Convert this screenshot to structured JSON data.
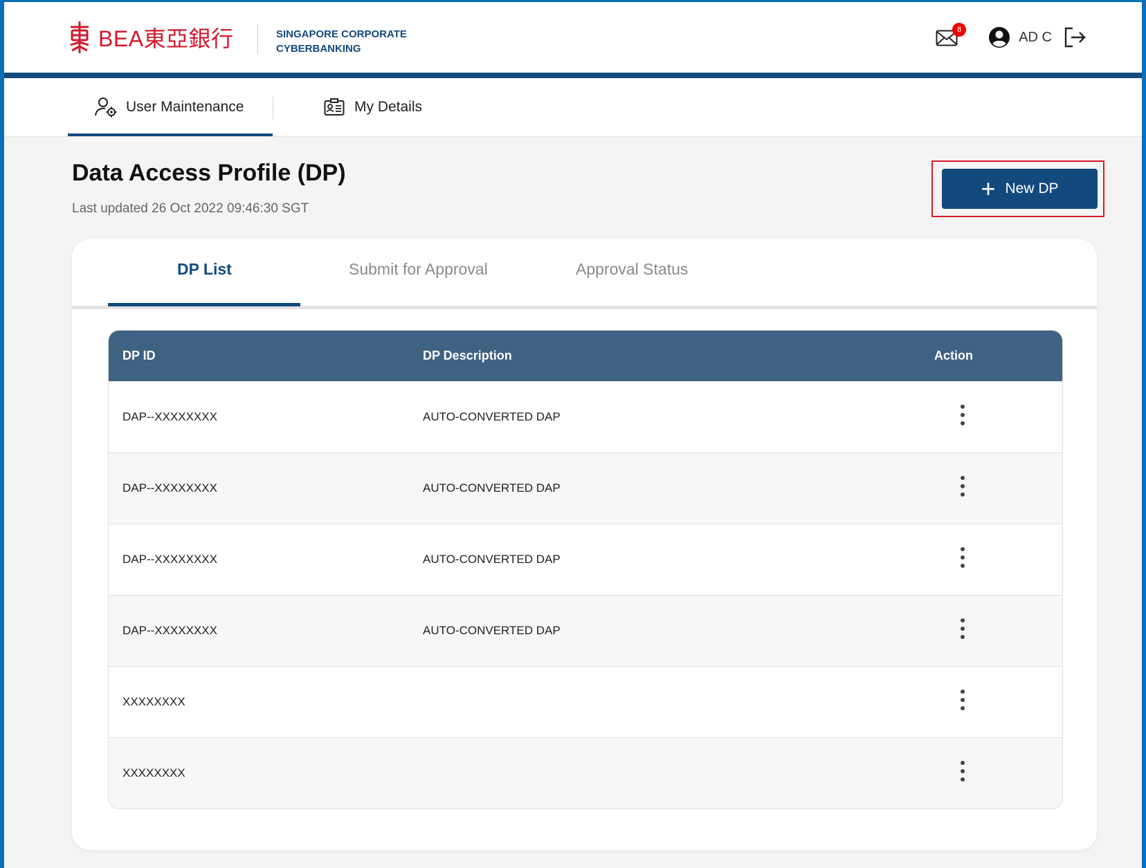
{
  "header": {
    "logo_text": "BEA東亞銀行",
    "subtitle_line1": "SINGAPORE CORPORATE",
    "subtitle_line2": "CYBERBANKING",
    "mail_badge_count": "8",
    "user_name": "AD C"
  },
  "topnav": {
    "tabs": [
      {
        "label": "User Maintenance",
        "active": true
      },
      {
        "label": "My Details",
        "active": false
      }
    ]
  },
  "page": {
    "title": "Data Access Profile (DP)",
    "last_updated": "Last updated 26 Oct 2022 09:46:30 SGT",
    "new_button_label": "New DP"
  },
  "card_tabs": [
    {
      "label": "DP List",
      "active": true
    },
    {
      "label": "Submit for Approval",
      "active": false
    },
    {
      "label": "Approval Status",
      "active": false
    }
  ],
  "table": {
    "columns": [
      "DP ID",
      "DP Description",
      "Action"
    ],
    "rows": [
      {
        "dp_id": "DAP--XXXXXXXX",
        "description": "AUTO-CONVERTED DAP"
      },
      {
        "dp_id": "DAP--XXXXXXXX",
        "description": "AUTO-CONVERTED DAP"
      },
      {
        "dp_id": "DAP--XXXXXXXX",
        "description": "AUTO-CONVERTED DAP"
      },
      {
        "dp_id": "DAP--XXXXXXXX",
        "description": "AUTO-CONVERTED DAP"
      },
      {
        "dp_id": "XXXXXXXX",
        "description": ""
      },
      {
        "dp_id": "XXXXXXXX",
        "description": ""
      }
    ]
  },
  "colors": {
    "brand_blue": "#134a7e",
    "table_header": "#3e6282",
    "logo_red": "#d0192c",
    "highlight_red": "#d81b2c"
  }
}
